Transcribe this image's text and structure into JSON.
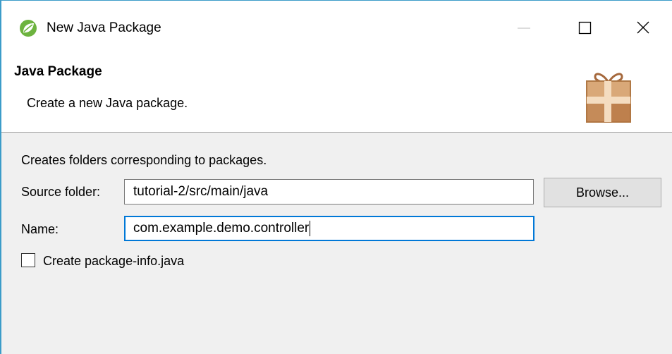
{
  "window": {
    "title": "New Java Package",
    "app_icon": "spring-leaf-icon",
    "controls": [
      "minimize-icon",
      "maximize-icon",
      "close-icon"
    ]
  },
  "header": {
    "title": "Java Package",
    "description": "Create a new Java package.",
    "image": "package-gift-icon"
  },
  "body": {
    "intro": "Creates folders corresponding to packages.",
    "source_folder": {
      "label": "Source folder:",
      "value": "tutorial-2/src/main/java",
      "browse_label": "Browse..."
    },
    "name": {
      "label": "Name:",
      "value": "com.example.demo.controller"
    },
    "package_info": {
      "label": "Create package-info.java",
      "checked": false
    }
  },
  "colors": {
    "window_border": "#3c9cc9",
    "focus_border": "#0078d7",
    "dialog_background": "#f0f0f0",
    "header_background": "#ffffff"
  }
}
